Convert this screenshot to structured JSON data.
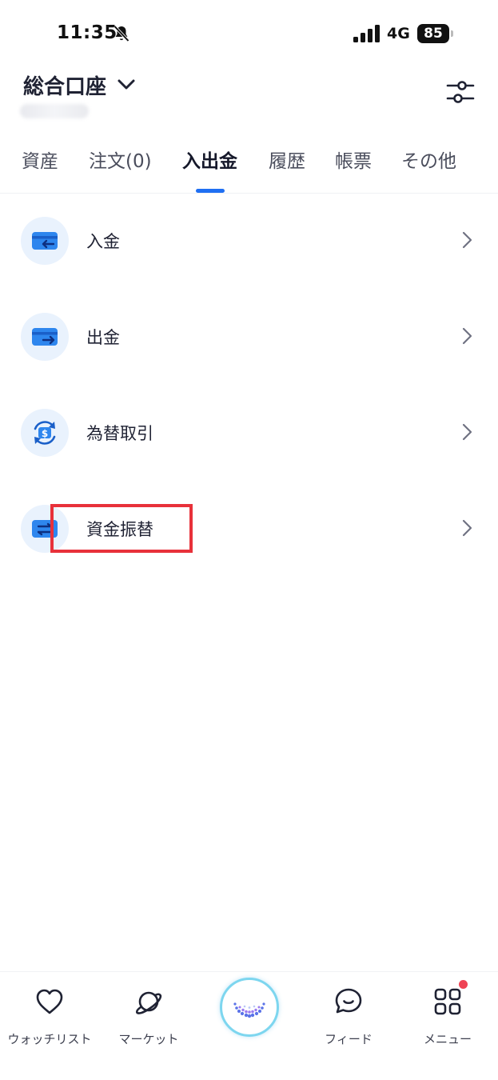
{
  "status_bar": {
    "time": "11:35",
    "network": "4G",
    "battery": "85"
  },
  "header": {
    "account_title": "総合口座"
  },
  "tabs": [
    {
      "label": "資産"
    },
    {
      "label": "注文(0)"
    },
    {
      "label": "入出金",
      "active": true
    },
    {
      "label": "履歴"
    },
    {
      "label": "帳票"
    },
    {
      "label": "その他"
    }
  ],
  "menu_items": [
    {
      "label": "入金",
      "icon": "deposit-card-icon"
    },
    {
      "label": "出金",
      "icon": "withdraw-card-icon"
    },
    {
      "label": "為替取引",
      "icon": "currency-exchange-icon"
    },
    {
      "label": "資金振替",
      "icon": "fund-transfer-icon"
    }
  ],
  "bottom_nav": [
    {
      "label": "ウォッチリスト",
      "icon": "heart-icon"
    },
    {
      "label": "マーケット",
      "icon": "planet-icon"
    },
    {
      "label": "",
      "icon": "assistant-orb-icon"
    },
    {
      "label": "フィード",
      "icon": "chat-bubble-icon"
    },
    {
      "label": "メニュー",
      "icon": "grid-icon"
    }
  ],
  "colors": {
    "accent": "#1f6ff2",
    "icon_bg": "#e9f2fd",
    "highlight": "#e8313a",
    "notification": "#ef4354"
  }
}
